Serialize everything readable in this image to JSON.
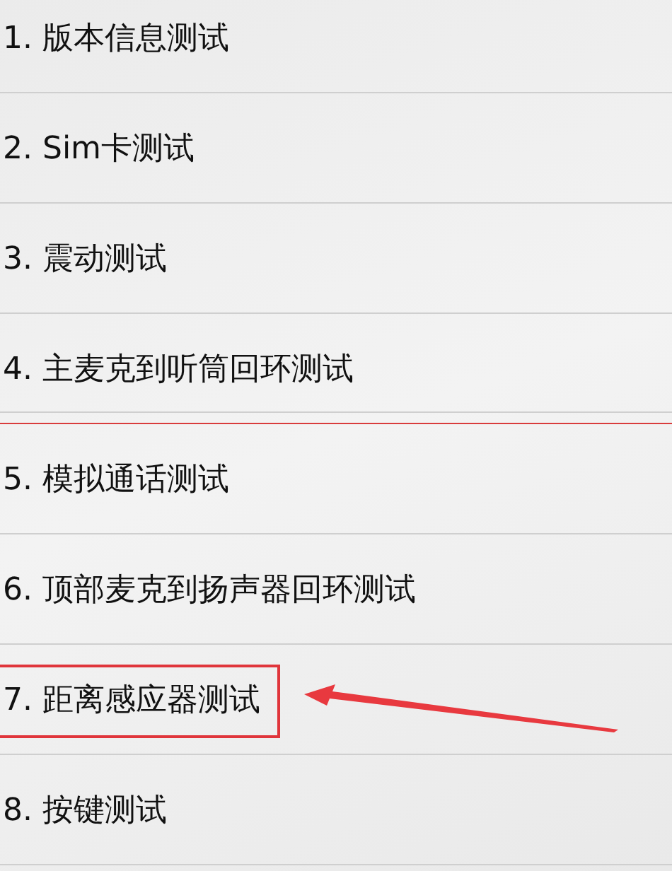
{
  "items": [
    {
      "label": "1. 版本信息测试",
      "highlighted": false,
      "red_rule_after": false
    },
    {
      "label": "2. Sim卡测试",
      "highlighted": false,
      "red_rule_after": false
    },
    {
      "label": "3. 震动测试",
      "highlighted": false,
      "red_rule_after": false
    },
    {
      "label": "4. 主麦克到听筒回环测试",
      "highlighted": false,
      "red_rule_after": true
    },
    {
      "label": "5. 模拟通话测试",
      "highlighted": false,
      "red_rule_after": false
    },
    {
      "label": "6. 顶部麦克到扬声器回环测试",
      "highlighted": false,
      "red_rule_after": false
    },
    {
      "label": "7. 距离感应器测试",
      "highlighted": true,
      "red_rule_after": false
    },
    {
      "label": "8. 按键测试",
      "highlighted": false,
      "red_rule_after": false
    }
  ]
}
